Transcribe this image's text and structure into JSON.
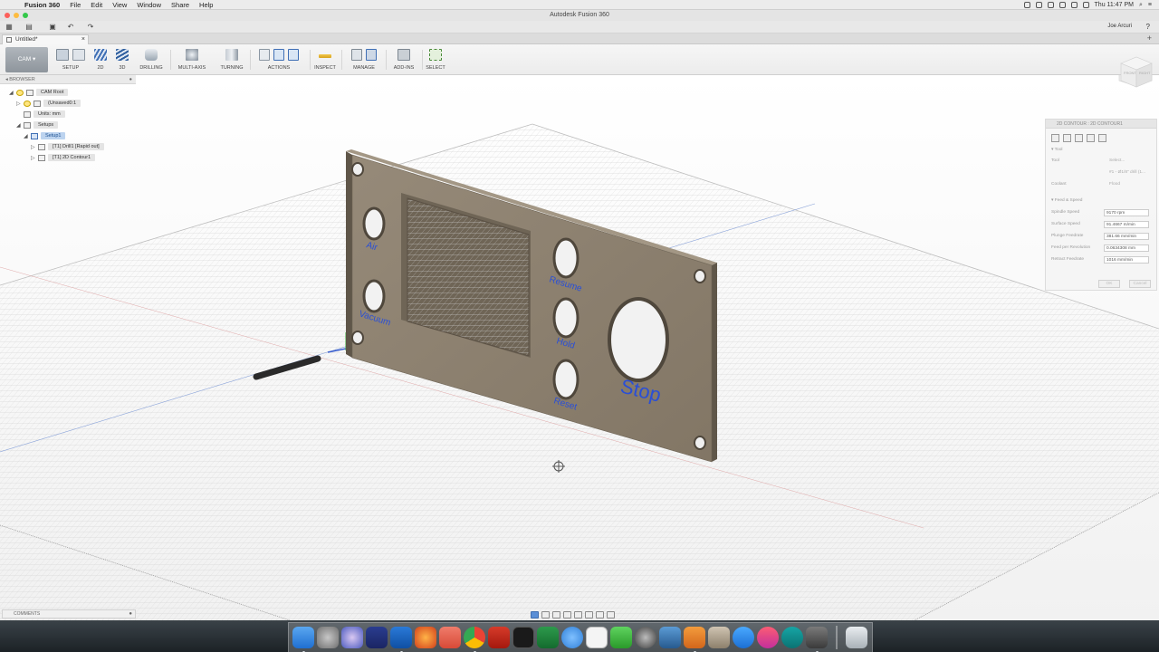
{
  "menubar": {
    "app_name": "Fusion 360",
    "items": [
      "File",
      "Edit",
      "View",
      "Window",
      "Share",
      "Help"
    ],
    "clock": "Thu 11:47 PM"
  },
  "window": {
    "title": "Autodesk Fusion 360"
  },
  "quickbar": {
    "user": "Joe Arcuri"
  },
  "document_tab": {
    "name": "Untitled*"
  },
  "toolbar": {
    "workspace": "CAM",
    "groups": [
      "SETUP",
      "2D",
      "3D",
      "DRILLING",
      "MULTI-AXIS",
      "TURNING",
      "ACTIONS",
      "INSPECT",
      "MANAGE",
      "ADD-INS",
      "SELECT"
    ]
  },
  "browser": {
    "title": "BROWSER",
    "nodes": [
      "CAM Root",
      "(Unsaved0:1",
      "Units: mm",
      "Setups",
      "Setup1",
      "[T1] Drill1 [Rapid out]",
      "[T1] 2D Contour1"
    ]
  },
  "panel": {
    "labels": [
      "Air",
      "Vacuum",
      "Resume",
      "Hold",
      "Reset",
      "Stop"
    ]
  },
  "properties": {
    "title": "2D CONTOUR : 2D CONTOUR1",
    "tool_section": "Tool",
    "tool_label": "Tool",
    "tool_value": "Select...",
    "tool_desc": "#1 - Ø1/8\" drill (1...",
    "coolant_label": "Coolant",
    "coolant_value": "Flood",
    "feed_section": "Feed & Speed",
    "fields": [
      {
        "label": "Spindle Speed",
        "value": "9170 rpm"
      },
      {
        "label": "Surface Speed",
        "value": "91.4667 m/min"
      },
      {
        "label": "Plunge Feedrate",
        "value": "381.66 mm/min"
      },
      {
        "label": "Feed per Revolution",
        "value": "0.0634308 mm"
      },
      {
        "label": "Retract Feedrate",
        "value": "1016 mm/min"
      }
    ],
    "ok": "OK",
    "cancel": "Cancel"
  },
  "comments": {
    "title": "COMMENTS"
  },
  "viewcube": {
    "front": "FRONT",
    "right": "RIGHT"
  },
  "colors": {
    "panel_face": "#8c8070",
    "panel_side": "#5f5649",
    "label_blue": "#2a4fd6",
    "bed_line": "#c9c9c9"
  }
}
